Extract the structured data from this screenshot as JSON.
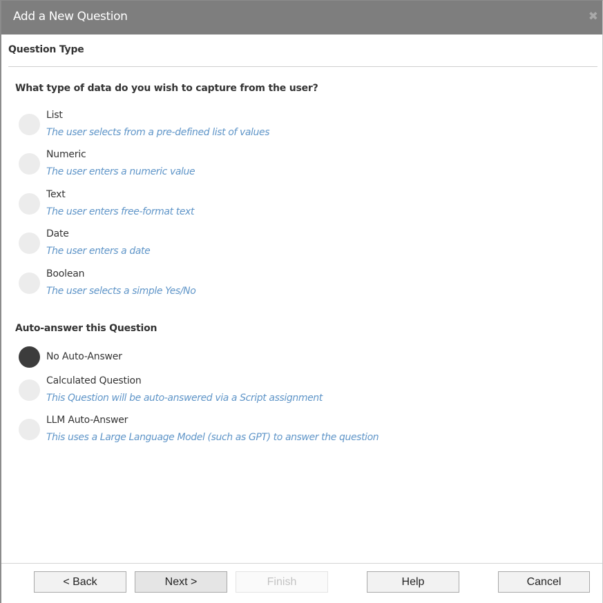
{
  "dialog": {
    "title": "Add a New Question",
    "close_glyph": "✖"
  },
  "section": {
    "title": "Question Type"
  },
  "data_type": {
    "heading": "What type of data do you wish to capture from the user?",
    "options": [
      {
        "label": "List",
        "description": "The user selects from a pre-defined list of values",
        "selected": false
      },
      {
        "label": "Numeric",
        "description": "The user enters a numeric value",
        "selected": false
      },
      {
        "label": "Text",
        "description": "The user enters free-format text",
        "selected": false
      },
      {
        "label": "Date",
        "description": "The user enters a date",
        "selected": false
      },
      {
        "label": "Boolean",
        "description": "The user selects a simple Yes/No",
        "selected": false
      }
    ]
  },
  "auto_answer": {
    "heading": "Auto-answer this Question",
    "options": [
      {
        "label": "No Auto-Answer",
        "description": "",
        "selected": true
      },
      {
        "label": "Calculated Question",
        "description": "This Question will be auto-answered via a Script assignment",
        "selected": false
      },
      {
        "label": "LLM Auto-Answer",
        "description": "This uses a Large Language Model (such as GPT) to answer the question",
        "selected": false
      }
    ]
  },
  "footer": {
    "back_label": "< Back",
    "next_label": "Next >",
    "finish_label": "Finish",
    "help_label": "Help",
    "cancel_label": "Cancel"
  },
  "colors": {
    "titlebar": "#7e7e7e",
    "description_text": "#5f95c8",
    "radio_unchecked": "#ececec",
    "radio_checked": "#3c3c3c"
  }
}
